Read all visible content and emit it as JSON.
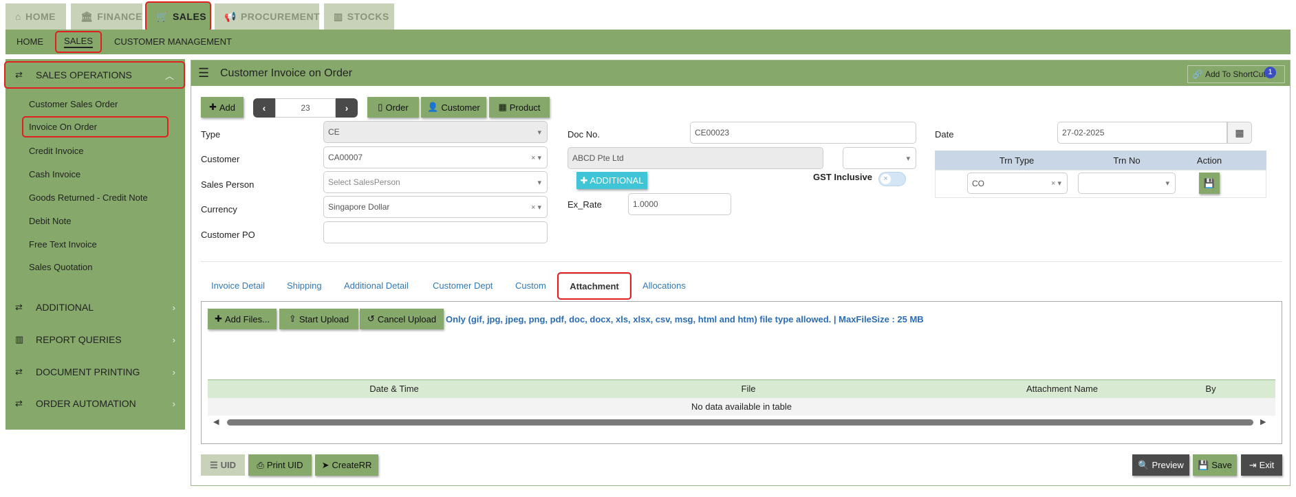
{
  "top_tabs": [
    {
      "label": "HOME",
      "icon": "home-icon"
    },
    {
      "label": "FINANCE",
      "icon": "bank-icon"
    },
    {
      "label": "SALES",
      "icon": "cart-icon"
    },
    {
      "label": "PROCUREMENT",
      "icon": "megaphone-icon"
    },
    {
      "label": "STOCKS",
      "icon": "bar-chart-icon"
    }
  ],
  "sub_nav": [
    "HOME",
    "SALES",
    "CUSTOMER MANAGEMENT"
  ],
  "sidebar": {
    "sections": [
      {
        "label": "SALES OPERATIONS",
        "icon": "exchange-icon"
      },
      {
        "label": "ADDITIONAL",
        "icon": "exchange-icon"
      },
      {
        "label": "REPORT QUERIES",
        "icon": "bar-chart-icon"
      },
      {
        "label": "DOCUMENT PRINTING",
        "icon": "exchange-icon"
      },
      {
        "label": "ORDER AUTOMATION",
        "icon": "exchange-icon"
      }
    ],
    "items": [
      "Customer Sales Order",
      "Invoice On Order",
      "Credit Invoice",
      "Cash Invoice",
      "Goods Returned - Credit Note",
      "Debit Note",
      "Free Text Invoice",
      "Sales Quotation"
    ]
  },
  "header": {
    "title": "Customer Invoice on Order",
    "shortcut_label": "Add To ShortCut",
    "shortcut_badge": "1"
  },
  "toolbar": {
    "add": "Add",
    "record_number": "23",
    "order": "Order",
    "customer": "Customer",
    "product": "Product"
  },
  "form": {
    "type_label": "Type",
    "type_value": "CE",
    "customer_label": "Customer",
    "customer_value": "CA00007",
    "sales_person_label": "Sales Person",
    "sales_person_placeholder": "Select SalesPerson",
    "currency_label": "Currency",
    "currency_value": "Singapore Dollar",
    "customer_po_label": "Customer PO",
    "customer_po_value": "",
    "doc_no_label": "Doc No.",
    "doc_no_value": "CE00023",
    "customer_name": "ABCD Pte Ltd",
    "additional_button": "ADDITIONAL",
    "gst_label": "GST Inclusive",
    "ex_rate_label": "Ex_Rate",
    "ex_rate_value": "1.0000",
    "date_label": "Date",
    "date_value": "27-02-2025"
  },
  "trn_table": {
    "headers": [
      "Trn Type",
      "Trn No",
      "Action"
    ],
    "trn_type_value": "CO",
    "trn_no_value": ""
  },
  "tabs": [
    "Invoice Detail",
    "Shipping",
    "Additional Detail",
    "Customer Dept",
    "Custom",
    "Attachment",
    "Allocations"
  ],
  "active_tab": "Attachment",
  "attachment": {
    "add_files": "Add Files...",
    "start_upload": "Start Upload",
    "cancel_upload": "Cancel Upload",
    "note": "Only (gif, jpg, jpeg, png, pdf, doc, docx, xls, xlsx, csv, msg, html and htm) file type allowed. | MaxFileSize : 25 MB",
    "columns": [
      "Date & Time",
      "File",
      "Attachment Name",
      "By"
    ],
    "empty": "No data available in table"
  },
  "footer": {
    "uid": "UID",
    "print_uid": "Print UID",
    "create_rr": "CreateRR",
    "preview": "Preview",
    "save": "Save",
    "exit": "Exit"
  },
  "colors": {
    "primary_green": "#86a86b",
    "inactive_tab": "#c7d2b8",
    "highlight_red": "#e02020",
    "additional_cyan": "#3fc4d8"
  }
}
